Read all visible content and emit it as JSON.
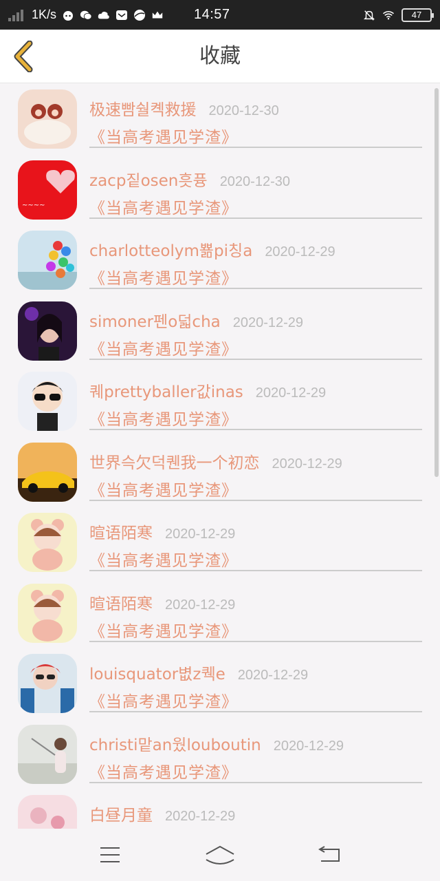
{
  "status_bar": {
    "speed": "1K/s",
    "time": "14:57",
    "battery": "47",
    "icons": [
      "signal-icon",
      "face-icon",
      "wechat-icon",
      "cloud-icon",
      "mail-icon",
      "ball-icon",
      "crown-icon",
      "mute-bell-icon",
      "wifi-icon",
      "battery-icon"
    ]
  },
  "header": {
    "title": "收藏",
    "back_icon": "chevron-left-icon",
    "accent_color": "#e8b23a"
  },
  "favorites": [
    {
      "user": "极速빰숼켹救援",
      "date": "2020-12-30",
      "book": "《当高考遇见学渣》"
    },
    {
      "user": "zacp짙osen흣퓽",
      "date": "2020-12-30",
      "book": "《当高考遇见学渣》"
    },
    {
      "user": "charlotteolym뾺pi칭a",
      "date": "2020-12-29",
      "book": "《当高考遇见学渣》"
    },
    {
      "user": "simoner펜o덟cha",
      "date": "2020-12-29",
      "book": "《当高考遇见学渣》"
    },
    {
      "user": "퀘prettyballer값inas",
      "date": "2020-12-29",
      "book": "《当高考遇见学渣》"
    },
    {
      "user": "世界슥欠덕퀜我一个初恋",
      "date": "2020-12-29",
      "book": "《当高考遇见学渣》"
    },
    {
      "user": "暄语陌寒",
      "date": "2020-12-29",
      "book": "《当高考遇见学渣》"
    },
    {
      "user": "暄语陌寒",
      "date": "2020-12-29",
      "book": "《当高考遇见学渣》"
    },
    {
      "user": "louisquator볎z퀙e",
      "date": "2020-12-29",
      "book": "《当高考遇见学渣》"
    },
    {
      "user": "christi맡an웠louboutin",
      "date": "2020-12-29",
      "book": "《当高考遇见学渣》"
    },
    {
      "user": "白昼月童",
      "date": "2020-12-29",
      "book": ""
    }
  ],
  "bottom_nav": {
    "icons": [
      "menu-icon",
      "home-icon",
      "back-icon"
    ]
  }
}
